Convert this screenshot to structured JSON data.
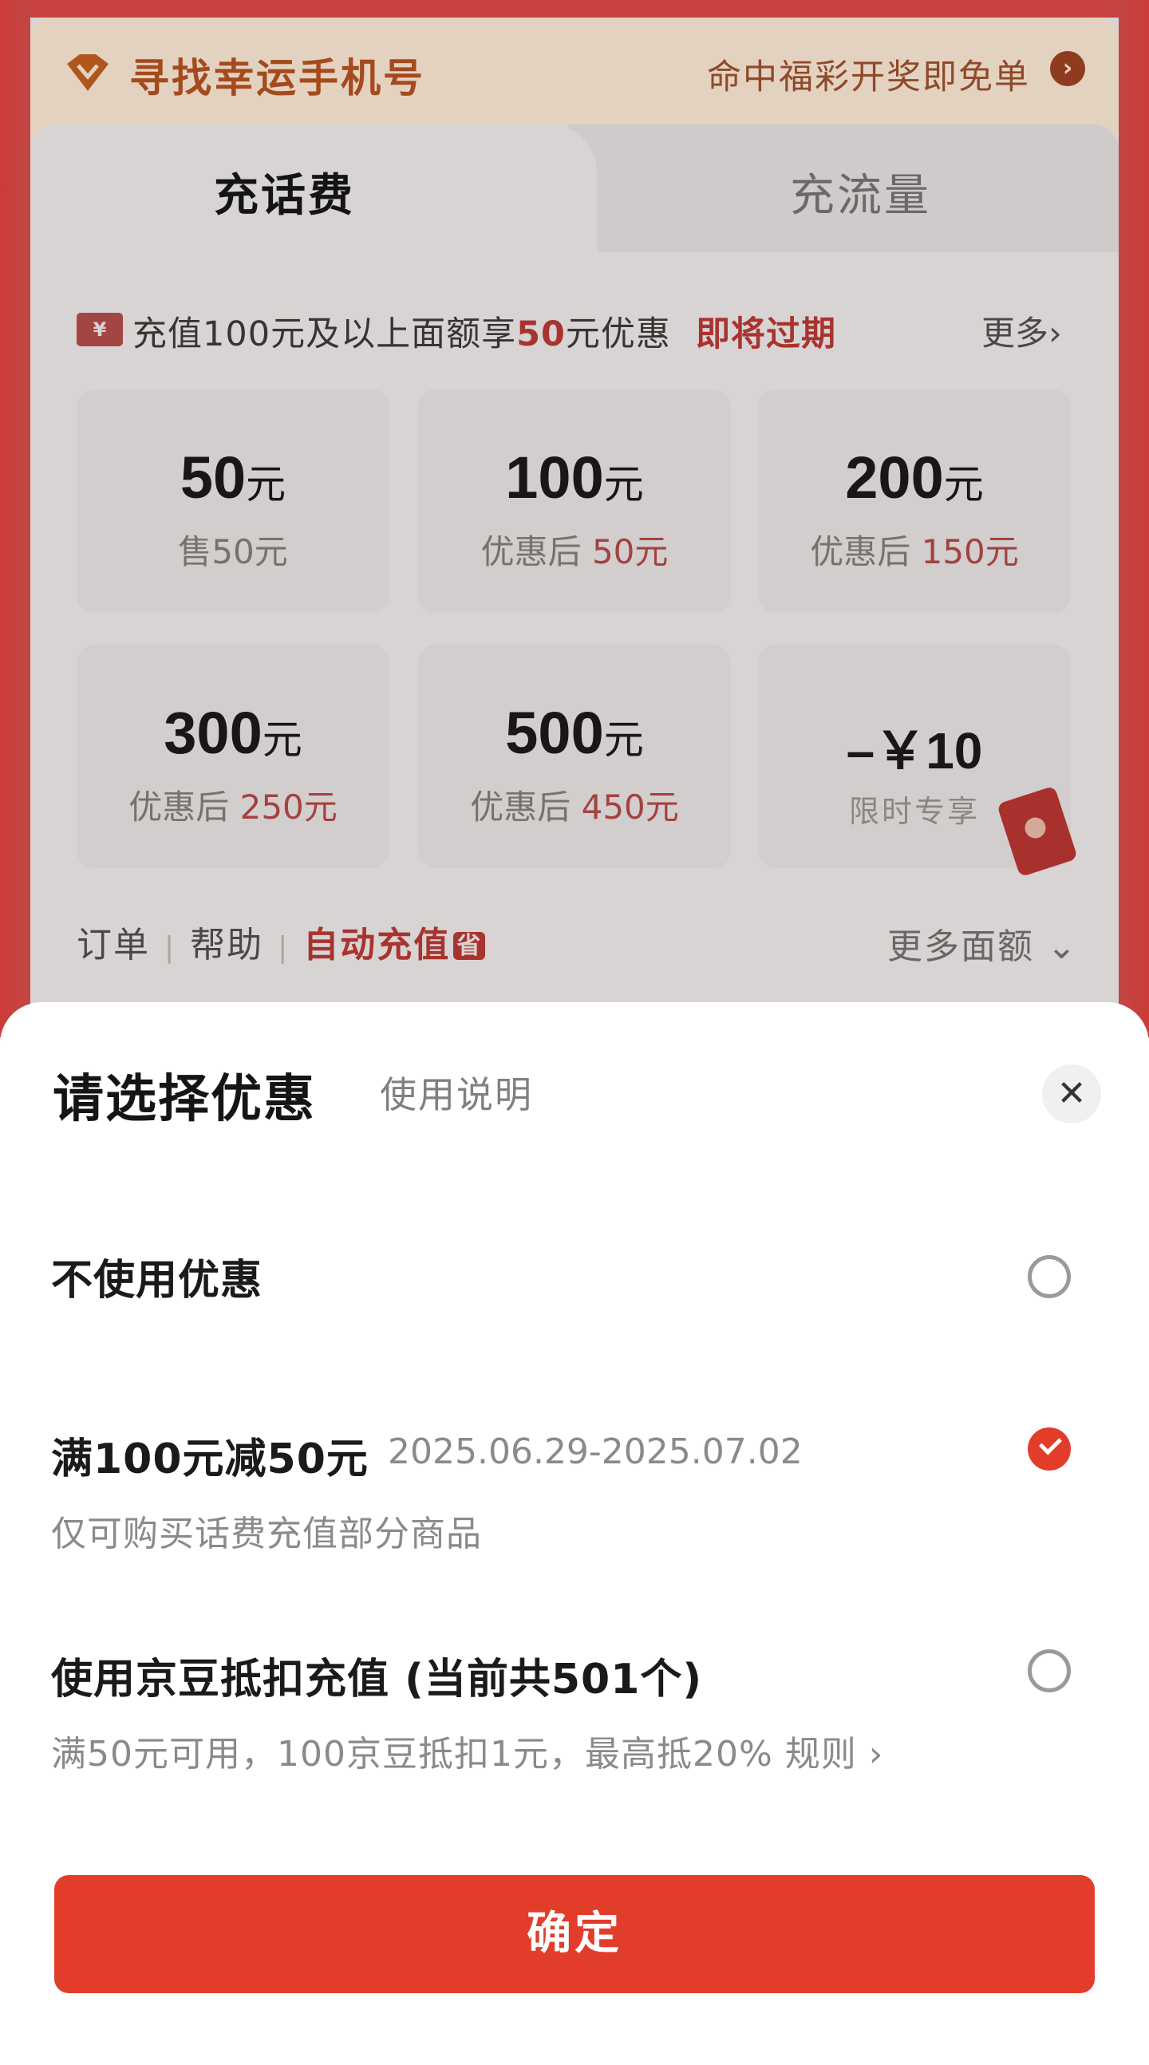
{
  "background": {
    "lucky_banner": {
      "title": "寻找幸运手机号",
      "promo": "命中福彩开奖即免单",
      "arrow": "›"
    },
    "tabs": [
      {
        "label": "充话费",
        "active": true
      },
      {
        "label": "充流量",
        "active": false
      }
    ],
    "promo": {
      "coupon_glyph": "¥",
      "text_before": "充值100元及以上面额享",
      "highlight": "50",
      "text_after": "元优惠",
      "expiring": "即将过期",
      "more": "更多›"
    },
    "tiles": [
      {
        "amount": "50",
        "unit": "元",
        "sub_label": "售50元",
        "price": ""
      },
      {
        "amount": "100",
        "unit": "元",
        "sub_label": "优惠后 ",
        "price": "50元"
      },
      {
        "amount": "200",
        "unit": "元",
        "sub_label": "优惠后 ",
        "price": "150元"
      },
      {
        "amount": "300",
        "unit": "元",
        "sub_label": "优惠后 ",
        "price": "250元"
      },
      {
        "amount": "500",
        "unit": "元",
        "sub_label": "优惠后 ",
        "price": "450元"
      }
    ],
    "discount_tile": {
      "discount": "–￥10",
      "label": "限时专享"
    },
    "footer": {
      "orders": "订单",
      "help": "帮助",
      "auto_recharge": "自动充值",
      "auto_badge": "省",
      "more_denominations": "更多面额 ⌄"
    }
  },
  "sheet": {
    "title": "请选择优惠",
    "help_link": "使用说明",
    "close_glyph": "✕",
    "options": [
      {
        "label": "不使用优惠",
        "date": "",
        "desc": "",
        "selected": false
      },
      {
        "label": "满100元减50元",
        "date": "2025.06.29-2025.07.02",
        "desc": "仅可购买话费充值部分商品",
        "selected": true
      },
      {
        "label": "使用京豆抵扣充值 (当前共501个)",
        "date": "",
        "desc": "满50元可用，100京豆抵扣1元，最高抵20%  规则 ›",
        "selected": false
      }
    ],
    "confirm": "确定"
  },
  "colors": {
    "accent": "#e23d2b",
    "sheet_bg": "#ffffff",
    "overlay_tint": "#d8d4d3"
  }
}
